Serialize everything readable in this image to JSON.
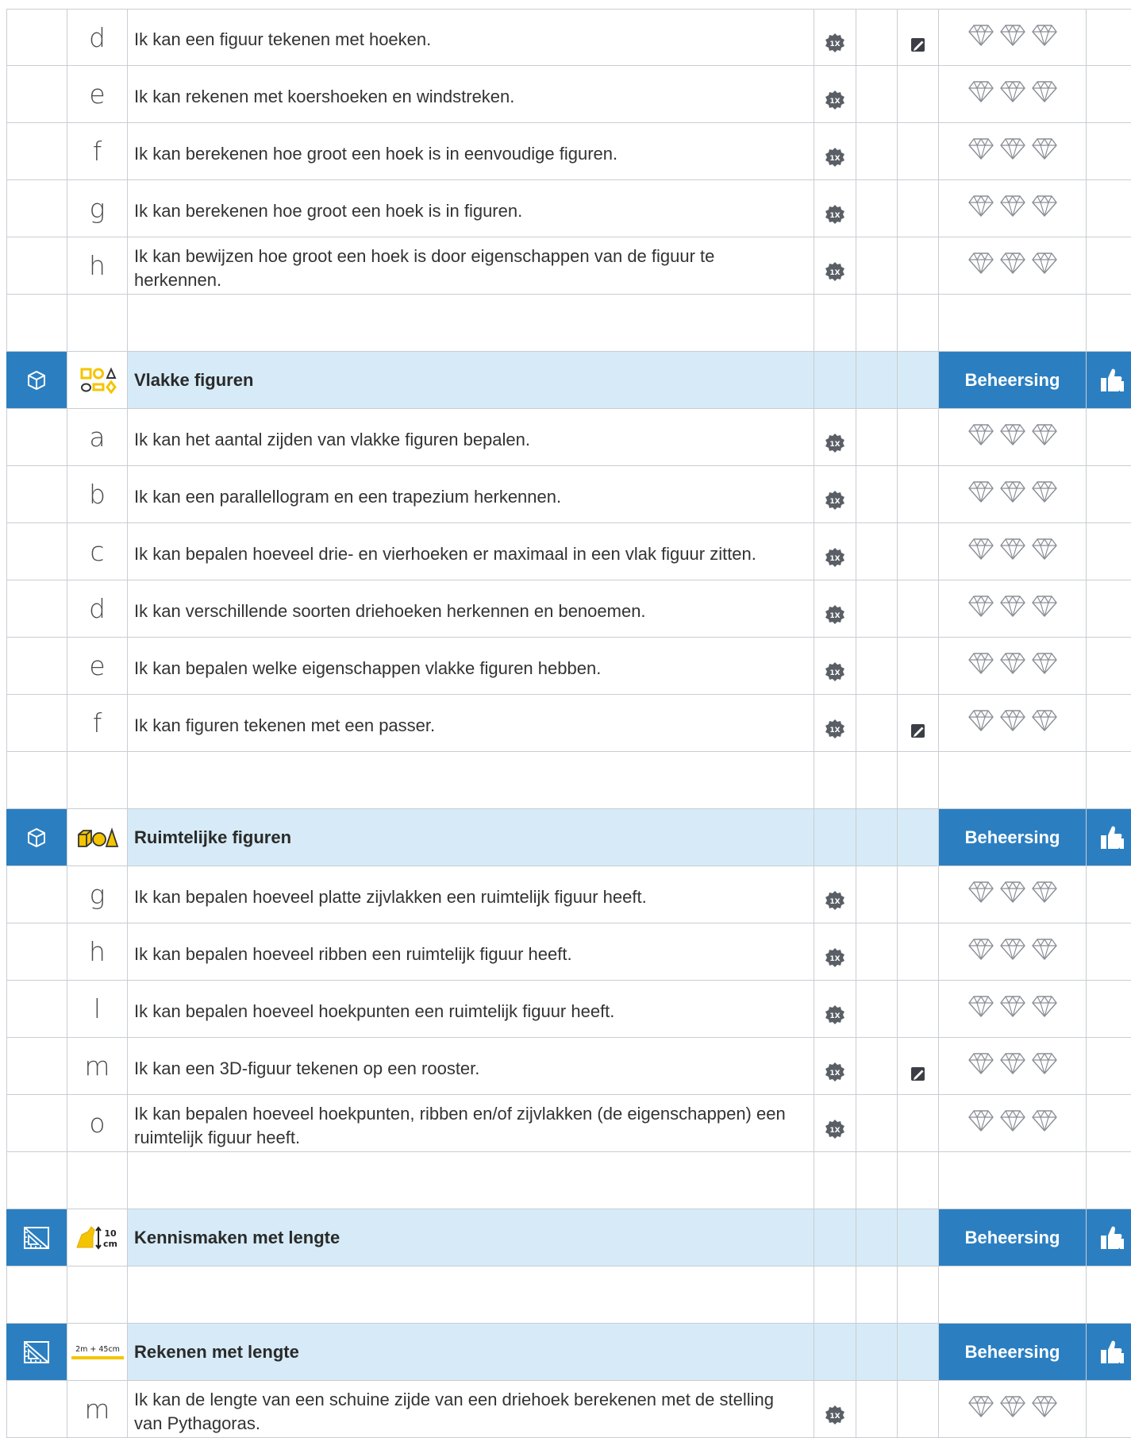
{
  "rows": [
    {
      "type": "item",
      "letter": "d",
      "text": "Ik kan een figuur tekenen met hoeken.",
      "badge": "1X",
      "pencil": true
    },
    {
      "type": "item",
      "letter": "e",
      "text": "Ik kan rekenen met koershoeken en windstreken.",
      "badge": "1X",
      "pencil": false
    },
    {
      "type": "item",
      "letter": "f",
      "text": "Ik kan berekenen hoe groot een hoek is in eenvoudige figuren.",
      "badge": "1X",
      "pencil": false
    },
    {
      "type": "item",
      "letter": "g",
      "text": "Ik kan berekenen hoe groot een hoek is in figuren.",
      "badge": "1X",
      "pencil": false
    },
    {
      "type": "item",
      "letter": "h",
      "text": "Ik kan bewijzen hoe groot een hoek is door eigenschappen van de figuur te herkennen.",
      "badge": "1X",
      "pencil": false
    },
    {
      "type": "empty"
    },
    {
      "type": "category",
      "icon": "cube-icon",
      "thumbnail": "shapes-thumbnail",
      "title": "Vlakke figuren",
      "status": "Beheersing"
    },
    {
      "type": "item",
      "letter": "a",
      "text": "Ik kan het aantal zijden van vlakke figuren bepalen.",
      "badge": "1X",
      "pencil": false
    },
    {
      "type": "item",
      "letter": "b",
      "text": "Ik kan een parallellogram en een trapezium herkennen.",
      "badge": "1X",
      "pencil": false
    },
    {
      "type": "item",
      "letter": "c",
      "text": "Ik kan bepalen hoeveel drie- en vierhoeken er maximaal in een vlak figuur zitten.",
      "badge": "1X",
      "pencil": false
    },
    {
      "type": "item",
      "letter": "d",
      "text": "Ik kan verschillende soorten driehoeken herkennen en benoemen.",
      "badge": "1X",
      "pencil": false
    },
    {
      "type": "item",
      "letter": "e",
      "text": "Ik kan bepalen welke eigenschappen vlakke figuren hebben.",
      "badge": "1X",
      "pencil": false
    },
    {
      "type": "item",
      "letter": "f",
      "text": "Ik kan figuren tekenen met een passer.",
      "badge": "1X",
      "pencil": true
    },
    {
      "type": "empty"
    },
    {
      "type": "category",
      "icon": "cube-icon",
      "thumbnail": "solids-thumbnail",
      "title": "Ruimtelijke figuren",
      "status": "Beheersing"
    },
    {
      "type": "item",
      "letter": "g",
      "text": "Ik kan bepalen hoeveel platte zijvlakken een ruimtelijk figuur heeft.",
      "badge": "1X",
      "pencil": false
    },
    {
      "type": "item",
      "letter": "h",
      "text": "Ik kan bepalen hoeveel ribben een ruimtelijk figuur heeft.",
      "badge": "1X",
      "pencil": false
    },
    {
      "type": "item",
      "letter": "l",
      "text": "Ik kan bepalen hoeveel hoekpunten een ruimtelijk figuur heeft.",
      "badge": "1X",
      "pencil": false
    },
    {
      "type": "item",
      "letter": "m",
      "text": "Ik kan een 3D-figuur tekenen op een rooster.",
      "badge": "1X",
      "pencil": true
    },
    {
      "type": "item",
      "letter": "o",
      "text": "Ik kan bepalen hoeveel hoekpunten, ribben en/of zijvlakken (de eigenschappen) een ruimtelijk figuur heeft.",
      "badge": "1X",
      "pencil": false
    },
    {
      "type": "empty"
    },
    {
      "type": "category",
      "icon": "ruler-square-icon",
      "thumbnail": "length-thumbnail",
      "thumb_text": "10 cm",
      "title": "Kennismaken met lengte",
      "status": "Beheersing"
    },
    {
      "type": "empty"
    },
    {
      "type": "category",
      "icon": "ruler-square-icon",
      "thumbnail": "sum-thumbnail",
      "thumb_text": "2m + 45cm",
      "title": "Rekenen met lengte",
      "status": "Beheersing"
    },
    {
      "type": "item",
      "letter": "m",
      "text": "Ik kan de lengte van een schuine zijde van een driehoek berekenen met de stelling van Pythagoras.",
      "badge": "1X",
      "pencil": false
    }
  ],
  "colors": {
    "accent": "#2b7fc1",
    "category_bg": "#d6ebf7",
    "badge": "#5a5f66",
    "gem_stroke": "#8a8f96",
    "thumbnail_yellow": "#f5c400"
  }
}
